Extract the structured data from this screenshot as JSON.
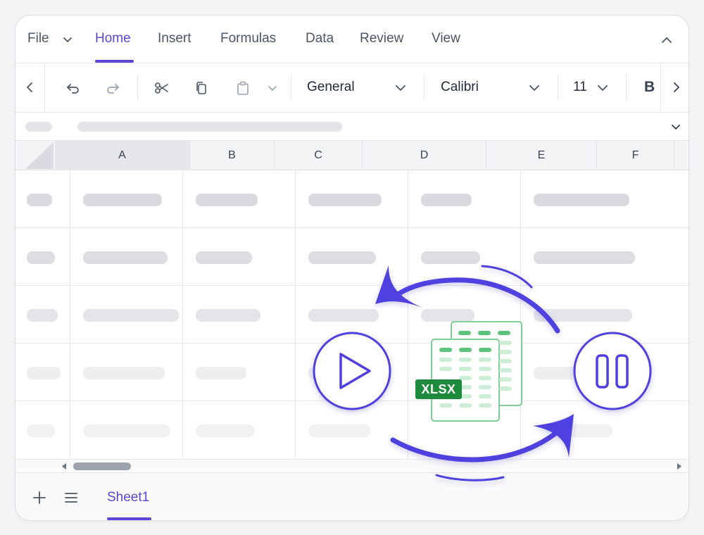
{
  "ribbon": {
    "tabs": [
      "File",
      "Home",
      "Insert",
      "Formulas",
      "Data",
      "Review",
      "View"
    ],
    "active": "Home"
  },
  "toolbar": {
    "number_format": "General",
    "font_name": "Calibri",
    "font_size": "11",
    "bold_label": "B"
  },
  "columns": [
    "A",
    "B",
    "C",
    "D",
    "E",
    "F"
  ],
  "sheets": {
    "active": "Sheet1"
  },
  "badge": {
    "label": "XLSX"
  },
  "colors": {
    "accent": "#5b46d6",
    "excel_green": "#1e8a3c"
  }
}
